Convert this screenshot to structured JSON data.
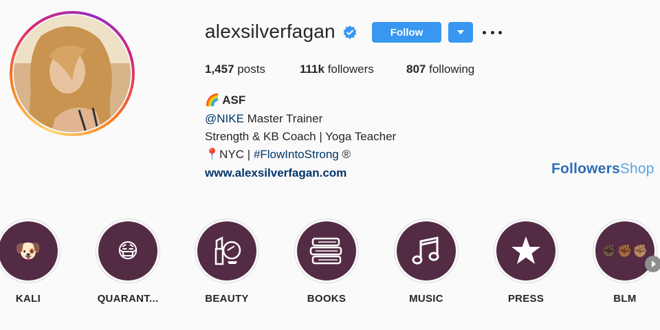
{
  "profile": {
    "username": "alexsilverfagan",
    "follow_label": "Follow",
    "stats": {
      "posts_count": "1,457",
      "posts_label": "posts",
      "followers_count": "111k",
      "followers_label": "followers",
      "following_count": "807",
      "following_label": "following"
    },
    "bio": {
      "name": "ASF",
      "name_emoji": "🌈",
      "line1_mention": "@NIKE",
      "line1_rest": " Master Trainer",
      "line2": "Strength & KB Coach | Yoga Teacher",
      "line3_pin": "📍",
      "line3_city": "NYC | ",
      "line3_hashtag": "#FlowIntoStrong",
      "line3_mark": " ®",
      "website": "www.alexsilverfagan.com"
    }
  },
  "watermark": {
    "part1": "Followers",
    "part2": "Shop"
  },
  "highlights": [
    {
      "label": "KALI",
      "icon": "🐶"
    },
    {
      "label": "QUARANT...",
      "icon": "😷"
    },
    {
      "label": "BEAUTY",
      "icon": "lipstick-mirror-icon"
    },
    {
      "label": "BOOKS",
      "icon": "books-icon"
    },
    {
      "label": "MUSIC",
      "icon": "music-note-icon"
    },
    {
      "label": "PRESS",
      "icon": "star-icon"
    },
    {
      "label": "BLM",
      "icon": "✊🏿✊🏾✊🏽"
    }
  ],
  "colors": {
    "follow_button": "#3897f0",
    "highlight_fill": "#542b45",
    "link": "#003569"
  }
}
